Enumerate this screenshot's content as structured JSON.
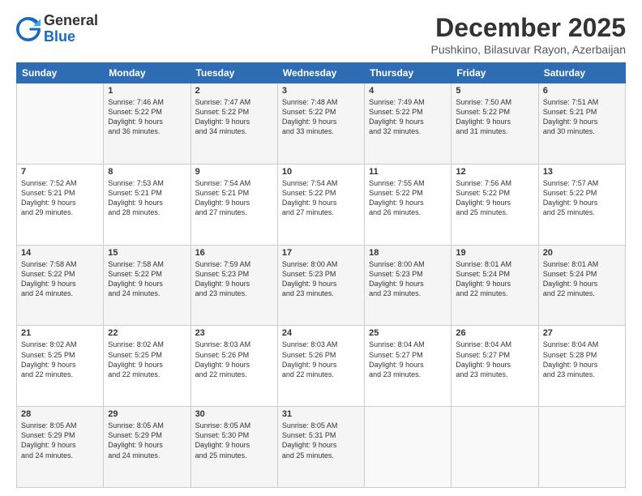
{
  "logo": {
    "general": "General",
    "blue": "Blue"
  },
  "title": "December 2025",
  "location": "Pushkino, Bilasuvar Rayon, Azerbaijan",
  "days_of_week": [
    "Sunday",
    "Monday",
    "Tuesday",
    "Wednesday",
    "Thursday",
    "Friday",
    "Saturday"
  ],
  "weeks": [
    [
      {
        "num": "",
        "info": ""
      },
      {
        "num": "1",
        "info": "Sunrise: 7:46 AM\nSunset: 5:22 PM\nDaylight: 9 hours\nand 36 minutes."
      },
      {
        "num": "2",
        "info": "Sunrise: 7:47 AM\nSunset: 5:22 PM\nDaylight: 9 hours\nand 34 minutes."
      },
      {
        "num": "3",
        "info": "Sunrise: 7:48 AM\nSunset: 5:22 PM\nDaylight: 9 hours\nand 33 minutes."
      },
      {
        "num": "4",
        "info": "Sunrise: 7:49 AM\nSunset: 5:22 PM\nDaylight: 9 hours\nand 32 minutes."
      },
      {
        "num": "5",
        "info": "Sunrise: 7:50 AM\nSunset: 5:22 PM\nDaylight: 9 hours\nand 31 minutes."
      },
      {
        "num": "6",
        "info": "Sunrise: 7:51 AM\nSunset: 5:21 PM\nDaylight: 9 hours\nand 30 minutes."
      }
    ],
    [
      {
        "num": "7",
        "info": "Sunrise: 7:52 AM\nSunset: 5:21 PM\nDaylight: 9 hours\nand 29 minutes."
      },
      {
        "num": "8",
        "info": "Sunrise: 7:53 AM\nSunset: 5:21 PM\nDaylight: 9 hours\nand 28 minutes."
      },
      {
        "num": "9",
        "info": "Sunrise: 7:54 AM\nSunset: 5:21 PM\nDaylight: 9 hours\nand 27 minutes."
      },
      {
        "num": "10",
        "info": "Sunrise: 7:54 AM\nSunset: 5:22 PM\nDaylight: 9 hours\nand 27 minutes."
      },
      {
        "num": "11",
        "info": "Sunrise: 7:55 AM\nSunset: 5:22 PM\nDaylight: 9 hours\nand 26 minutes."
      },
      {
        "num": "12",
        "info": "Sunrise: 7:56 AM\nSunset: 5:22 PM\nDaylight: 9 hours\nand 25 minutes."
      },
      {
        "num": "13",
        "info": "Sunrise: 7:57 AM\nSunset: 5:22 PM\nDaylight: 9 hours\nand 25 minutes."
      }
    ],
    [
      {
        "num": "14",
        "info": "Sunrise: 7:58 AM\nSunset: 5:22 PM\nDaylight: 9 hours\nand 24 minutes."
      },
      {
        "num": "15",
        "info": "Sunrise: 7:58 AM\nSunset: 5:22 PM\nDaylight: 9 hours\nand 24 minutes."
      },
      {
        "num": "16",
        "info": "Sunrise: 7:59 AM\nSunset: 5:23 PM\nDaylight: 9 hours\nand 23 minutes."
      },
      {
        "num": "17",
        "info": "Sunrise: 8:00 AM\nSunset: 5:23 PM\nDaylight: 9 hours\nand 23 minutes."
      },
      {
        "num": "18",
        "info": "Sunrise: 8:00 AM\nSunset: 5:23 PM\nDaylight: 9 hours\nand 23 minutes."
      },
      {
        "num": "19",
        "info": "Sunrise: 8:01 AM\nSunset: 5:24 PM\nDaylight: 9 hours\nand 22 minutes."
      },
      {
        "num": "20",
        "info": "Sunrise: 8:01 AM\nSunset: 5:24 PM\nDaylight: 9 hours\nand 22 minutes."
      }
    ],
    [
      {
        "num": "21",
        "info": "Sunrise: 8:02 AM\nSunset: 5:25 PM\nDaylight: 9 hours\nand 22 minutes."
      },
      {
        "num": "22",
        "info": "Sunrise: 8:02 AM\nSunset: 5:25 PM\nDaylight: 9 hours\nand 22 minutes."
      },
      {
        "num": "23",
        "info": "Sunrise: 8:03 AM\nSunset: 5:26 PM\nDaylight: 9 hours\nand 22 minutes."
      },
      {
        "num": "24",
        "info": "Sunrise: 8:03 AM\nSunset: 5:26 PM\nDaylight: 9 hours\nand 22 minutes."
      },
      {
        "num": "25",
        "info": "Sunrise: 8:04 AM\nSunset: 5:27 PM\nDaylight: 9 hours\nand 23 minutes."
      },
      {
        "num": "26",
        "info": "Sunrise: 8:04 AM\nSunset: 5:27 PM\nDaylight: 9 hours\nand 23 minutes."
      },
      {
        "num": "27",
        "info": "Sunrise: 8:04 AM\nSunset: 5:28 PM\nDaylight: 9 hours\nand 23 minutes."
      }
    ],
    [
      {
        "num": "28",
        "info": "Sunrise: 8:05 AM\nSunset: 5:29 PM\nDaylight: 9 hours\nand 24 minutes."
      },
      {
        "num": "29",
        "info": "Sunrise: 8:05 AM\nSunset: 5:29 PM\nDaylight: 9 hours\nand 24 minutes."
      },
      {
        "num": "30",
        "info": "Sunrise: 8:05 AM\nSunset: 5:30 PM\nDaylight: 9 hours\nand 25 minutes."
      },
      {
        "num": "31",
        "info": "Sunrise: 8:05 AM\nSunset: 5:31 PM\nDaylight: 9 hours\nand 25 minutes."
      },
      {
        "num": "",
        "info": ""
      },
      {
        "num": "",
        "info": ""
      },
      {
        "num": "",
        "info": ""
      }
    ]
  ]
}
